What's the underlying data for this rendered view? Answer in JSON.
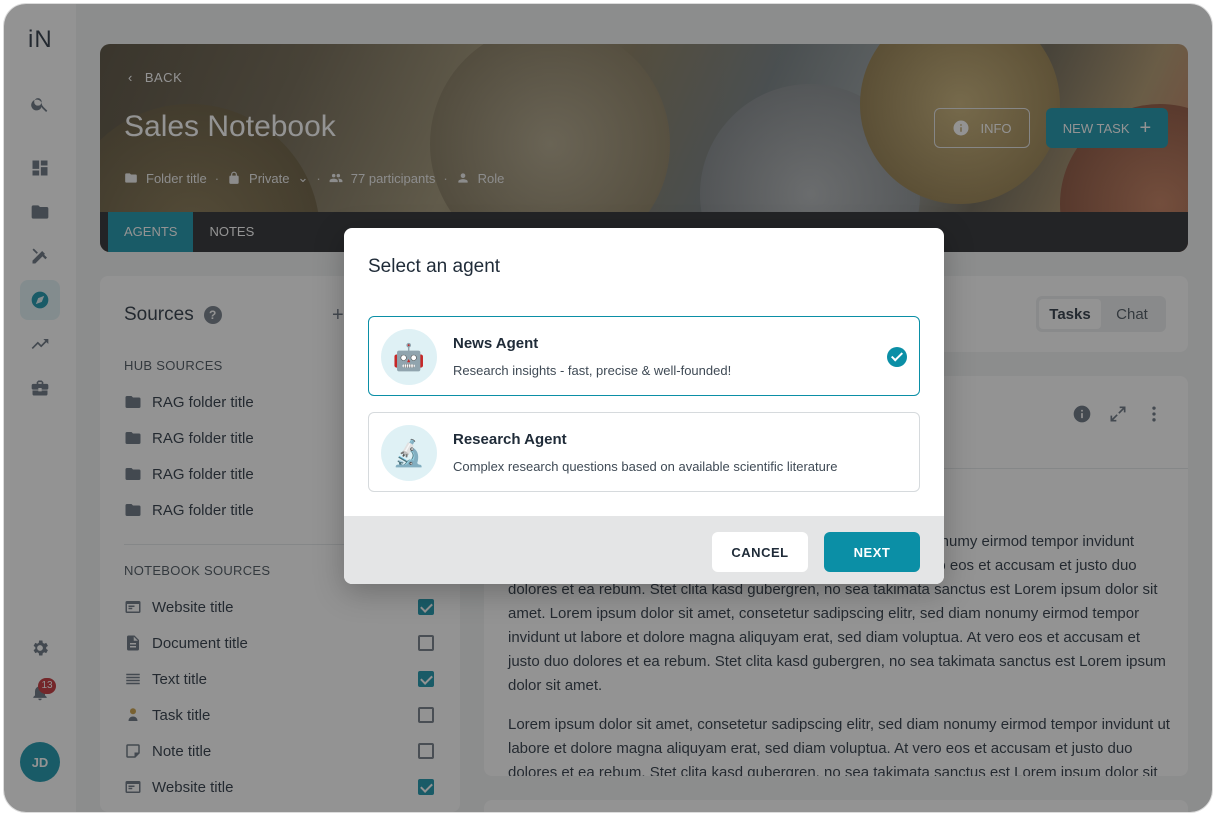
{
  "app": {
    "logo": "iN",
    "accent": "#0b8fa6",
    "notification_count": "13",
    "user_initials": "JD"
  },
  "sidebar": {
    "items": [
      {
        "name": "search-icon"
      },
      {
        "name": "dashboard-icon"
      },
      {
        "name": "folder-icon"
      },
      {
        "name": "tools-icon"
      },
      {
        "name": "compass-icon",
        "active": true
      },
      {
        "name": "trending-icon"
      },
      {
        "name": "briefcase-icon"
      }
    ],
    "bottom": [
      {
        "name": "gear-icon"
      },
      {
        "name": "bell-icon"
      }
    ]
  },
  "header": {
    "back_label": "BACK",
    "title": "Sales Notebook",
    "folder": "Folder title",
    "privacy": "Private",
    "participants": "77 participants",
    "role": "Role",
    "info_label": "INFO",
    "new_task_label": "NEW TASK",
    "tabs": [
      {
        "label": "AGENTS",
        "active": true
      },
      {
        "label": "NOTES",
        "active": false
      }
    ]
  },
  "sources": {
    "title": "Sources",
    "hub_label": "HUB SOURCES",
    "hub_items": [
      "RAG folder title",
      "RAG folder title",
      "RAG folder title",
      "RAG folder title"
    ],
    "notebook_label": "NOTEBOOK SOURCES",
    "notebook_items": [
      {
        "label": "Website title",
        "icon": "website-icon",
        "checked": true
      },
      {
        "label": "Document title",
        "icon": "document-icon",
        "checked": false
      },
      {
        "label": "Text title",
        "icon": "text-icon",
        "checked": true
      },
      {
        "label": "Task title",
        "icon": "task-icon",
        "checked": false
      },
      {
        "label": "Note title",
        "icon": "note-icon",
        "checked": false
      },
      {
        "label": "Website title",
        "icon": "website-icon",
        "checked": true
      }
    ]
  },
  "view_toggle": {
    "tasks": "Tasks",
    "chat": "Chat",
    "selected": "Tasks"
  },
  "content": {
    "para1_partial": "nonumy eirmod tempor invidunt",
    "para1_partial2": "ero eos et accusam et justo duo",
    "para1": "dolores et ea rebum. Stet clita kasd gubergren, no sea takimata sanctus est Lorem ipsum dolor sit amet. Lorem ipsum dolor sit amet, consetetur sadipscing elitr, sed diam nonumy eirmod tempor invidunt ut labore et dolore magna aliquyam erat, sed diam voluptua. At vero eos et accusam et justo duo dolores et ea rebum. Stet clita kasd gubergren, no sea takimata sanctus est Lorem ipsum dolor sit amet.",
    "para2": "Lorem ipsum dolor sit amet, consetetur sadipscing elitr, sed diam nonumy eirmod tempor invidunt ut labore et dolore magna aliquyam erat, sed diam voluptua. At vero eos et accusam et justo duo dolores et ea rebum. Stet clita kasd gubergren, no sea takimata sanctus est Lorem ipsum dolor sit"
  },
  "modal": {
    "title": "Select an agent",
    "agents": [
      {
        "name": "News Agent",
        "description": "Research insights - fast, precise & well-founded!",
        "icon": "robot-icon",
        "selected": true
      },
      {
        "name": "Research Agent",
        "description": "Complex research questions based on available scientific literature",
        "icon": "microscope-icon",
        "selected": false
      }
    ],
    "cancel_label": "CANCEL",
    "next_label": "NEXT"
  }
}
